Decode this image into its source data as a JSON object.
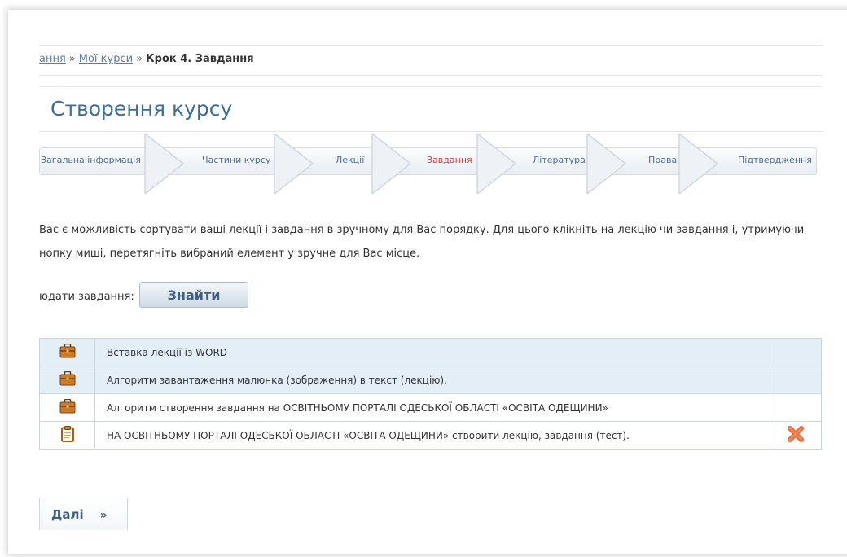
{
  "breadcrumb": {
    "items": [
      {
        "label": "ання",
        "link": true
      },
      {
        "label": "Мої курси",
        "link": true
      },
      {
        "label": "Крок 4. Завдання",
        "link": false
      }
    ],
    "separator": "»"
  },
  "page_title": "Створення курсу",
  "steps": [
    {
      "label": "Загальна інформація",
      "active": false
    },
    {
      "label": "Частини курсу",
      "active": false
    },
    {
      "label": "Лекції",
      "active": false
    },
    {
      "label": "Завдання",
      "active": true
    },
    {
      "label": "Література",
      "active": false
    },
    {
      "label": "Права",
      "active": false
    },
    {
      "label": "Підтвердження",
      "active": false
    }
  ],
  "info": {
    "line1": " Вас є можливість сортувати ваші лекції і завдання в зручному для Вас порядку. Для цього клікніть на лекцію чи завдання і, утримуючи",
    "line2": "нопку миші, перетягніть вибраний елемент у зручне для Вас місце."
  },
  "add_task": {
    "label": "юдати завдання:",
    "button": "Знайти"
  },
  "items": [
    {
      "icon": "briefcase-icon",
      "title": "Вставка лекції із WORD",
      "removable": false,
      "highlighted": true
    },
    {
      "icon": "briefcase-icon",
      "title": "Алгоритм завантаження малюнка (зображення) в текст (лекцію).",
      "removable": false,
      "highlighted": true
    },
    {
      "icon": "briefcase-icon",
      "title": "Алгоритм створення завдання на ОСВІТНЬОМУ ПОРТАЛІ ОДЕСЬКОЇ ОБЛАСТІ «ОСВІТА ОДЕЩИНИ»",
      "removable": false,
      "highlighted": false
    },
    {
      "icon": "clipboard-icon",
      "title": "НА ОСВІТНЬОМУ ПОРТАЛІ ОДЕСЬКОЇ ОБЛАСТІ «ОСВІТА ОДЕЩИНИ» створити лекцію, завдання (тест).",
      "removable": true,
      "highlighted": false
    }
  ],
  "next_button": {
    "label": "Далі",
    "arrow": "»"
  },
  "colors": {
    "title": "#3c6e9a",
    "link": "#5b7da8",
    "active_step": "#d23a3a",
    "row_highlight": "#e4eef7",
    "delete_icon": "#e8643c"
  }
}
